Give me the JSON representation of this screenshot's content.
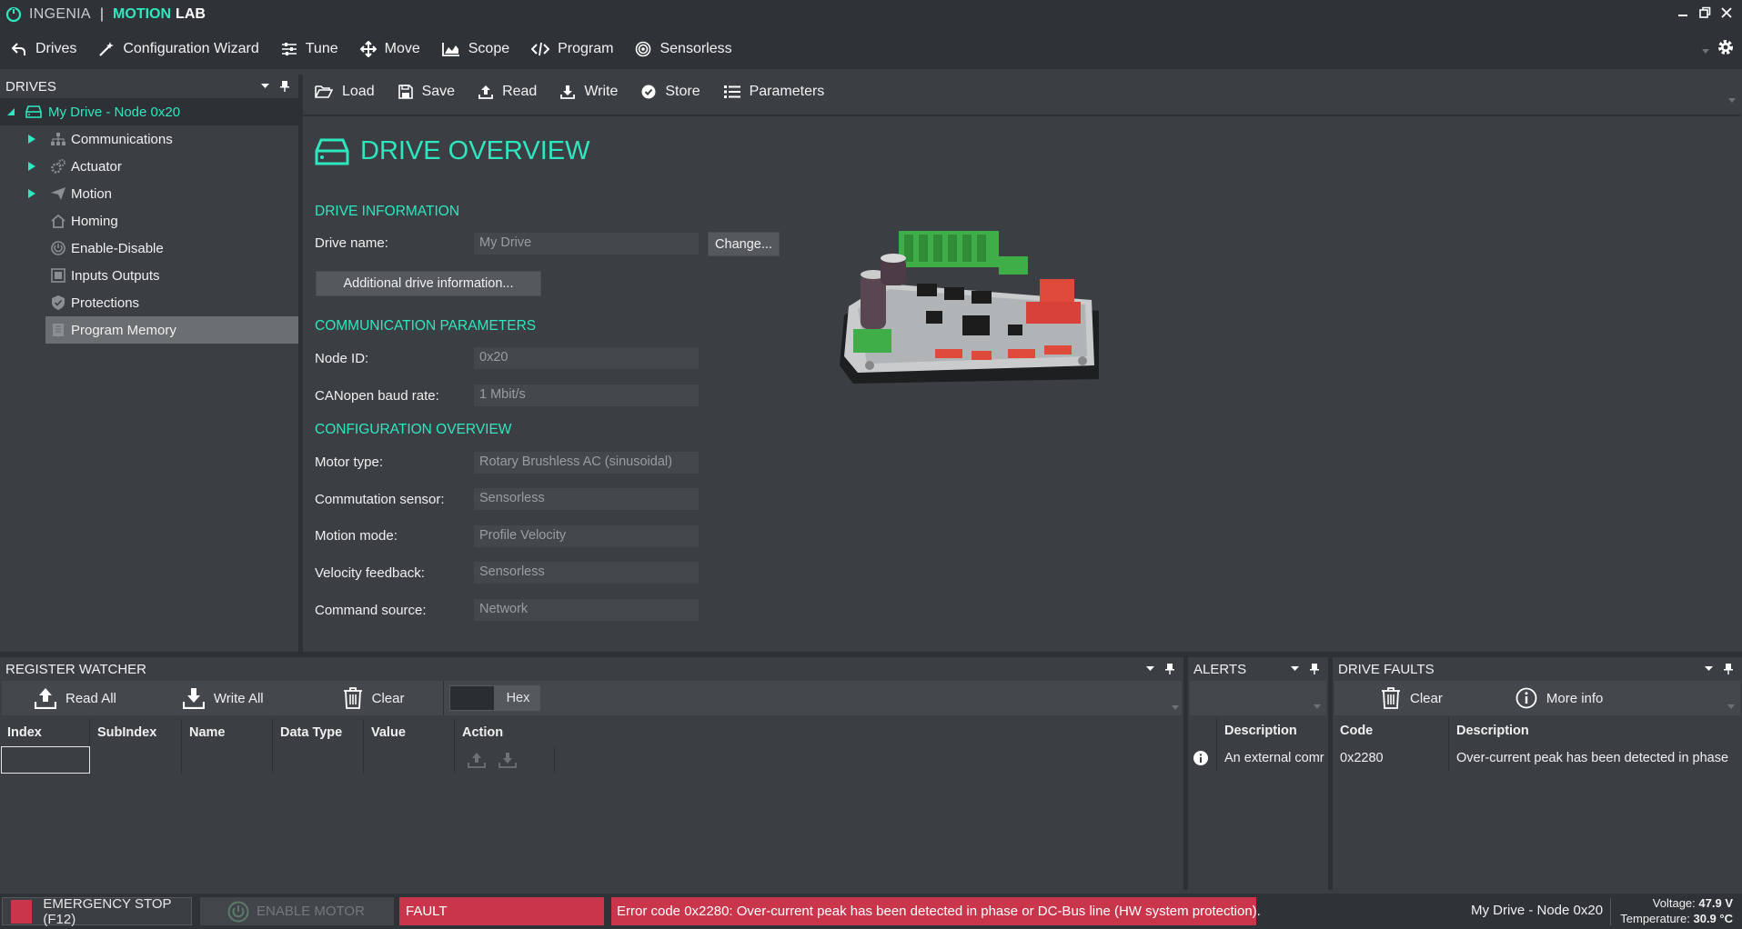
{
  "app": {
    "brand": "INGENIA",
    "separator": "|",
    "product_a": "MOTION",
    "product_b": "LAB",
    "accent_color": "#2ee7bf"
  },
  "main_toolbar": {
    "items": [
      {
        "label": "Drives",
        "icon": "back-arrow-icon"
      },
      {
        "label": "Configuration Wizard",
        "icon": "magic-wand-icon"
      },
      {
        "label": "Tune",
        "icon": "sliders-icon"
      },
      {
        "label": "Move",
        "icon": "move-arrows-icon"
      },
      {
        "label": "Scope",
        "icon": "area-chart-icon"
      },
      {
        "label": "Program",
        "icon": "code-icon"
      },
      {
        "label": "Sensorless",
        "icon": "target-icon"
      }
    ]
  },
  "drives_panel": {
    "title": "DRIVES",
    "root": "My Drive - Node 0x20",
    "items": [
      {
        "label": "Communications",
        "expandable": true,
        "icon": "network-icon"
      },
      {
        "label": "Actuator",
        "expandable": true,
        "icon": "gears-icon"
      },
      {
        "label": "Motion",
        "expandable": true,
        "icon": "send-icon"
      },
      {
        "label": "Homing",
        "expandable": false,
        "icon": "home-icon"
      },
      {
        "label": "Enable-Disable",
        "expandable": false,
        "icon": "power-icon"
      },
      {
        "label": "Inputs Outputs",
        "expandable": false,
        "icon": "io-icon"
      },
      {
        "label": "Protections",
        "expandable": false,
        "icon": "shield-icon"
      },
      {
        "label": "Program Memory",
        "expandable": false,
        "icon": "memory-icon",
        "selected": true
      }
    ]
  },
  "center_toolbar": {
    "items": [
      {
        "label": "Load",
        "icon": "folder-open-icon"
      },
      {
        "label": "Save",
        "icon": "floppy-icon"
      },
      {
        "label": "Read",
        "icon": "upload-icon"
      },
      {
        "label": "Write",
        "icon": "download-icon"
      },
      {
        "label": "Store",
        "icon": "check-circle-icon"
      },
      {
        "label": "Parameters",
        "icon": "list-icon"
      }
    ]
  },
  "overview": {
    "title": "DRIVE OVERVIEW",
    "drive_info": {
      "title": "DRIVE INFORMATION",
      "name_label": "Drive name:",
      "name_value": "My Drive",
      "change_button": "Change...",
      "additional_button": "Additional drive information..."
    },
    "comm": {
      "title": "COMMUNICATION PARAMETERS",
      "node_label": "Node ID:",
      "node_value": "0x20",
      "baud_label": "CANopen baud rate:",
      "baud_value": "1 Mbit/s"
    },
    "config": {
      "title": "CONFIGURATION OVERVIEW",
      "fields": [
        {
          "label": "Motor type:",
          "value": "Rotary Brushless AC (sinusoidal)"
        },
        {
          "label": "Commutation sensor:",
          "value": "Sensorless"
        },
        {
          "label": "Motion mode:",
          "value": "Profile Velocity"
        },
        {
          "label": "Velocity feedback:",
          "value": "Sensorless"
        },
        {
          "label": "Command source:",
          "value": "Network"
        }
      ]
    }
  },
  "register_watcher": {
    "title": "REGISTER WATCHER",
    "read_all": "Read All",
    "write_all": "Write All",
    "clear": "Clear",
    "hex": "Hex",
    "columns": [
      "Index",
      "SubIndex",
      "Name",
      "Data Type",
      "Value",
      "Action"
    ]
  },
  "alerts": {
    "title": "ALERTS",
    "columns": [
      "Description"
    ],
    "rows": [
      {
        "description": "An external comr"
      }
    ]
  },
  "drive_faults": {
    "title": "DRIVE FAULTS",
    "clear": "Clear",
    "more_info": "More info",
    "columns": [
      "Code",
      "Description"
    ],
    "rows": [
      {
        "code": "0x2280",
        "description": "Over-current peak has been detected in phase"
      }
    ]
  },
  "status_bar": {
    "emergency": "EMERGENCY STOP (F12)",
    "enable_motor": "ENABLE MOTOR",
    "fault": "FAULT",
    "error_message": "Error code 0x2280: Over-current peak has been detected in phase or DC-Bus line (HW system protection).",
    "drive_name": "My Drive - Node 0x20",
    "voltage_label": "Voltage:",
    "voltage_value": "47.9 V",
    "temperature_label": "Temperature:",
    "temperature_value": "30.9 °C",
    "fault_color": "#c9364b"
  }
}
